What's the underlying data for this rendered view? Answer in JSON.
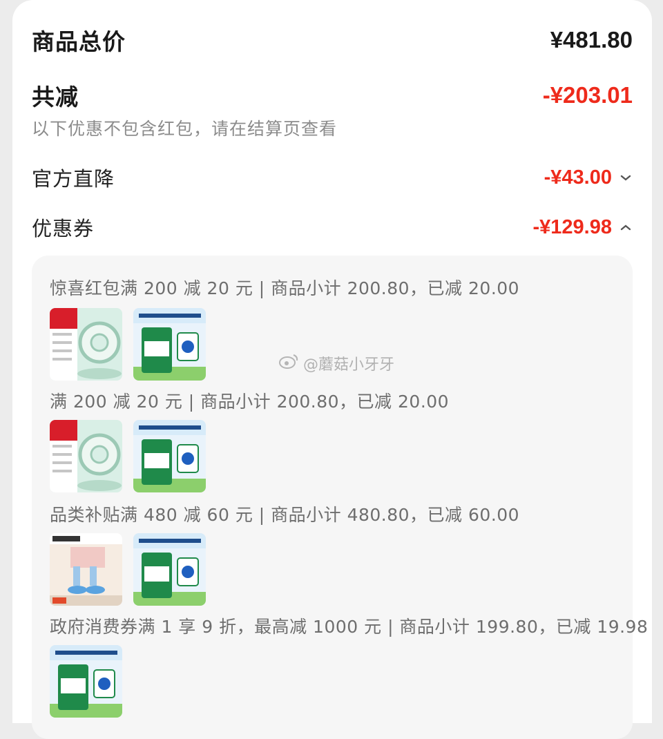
{
  "summary": {
    "total_label": "商品总价",
    "total_value": "¥481.80",
    "reduce_label": "共减",
    "reduce_value": "-¥203.01",
    "note": "以下优惠不包含红包，请在结算页查看"
  },
  "discounts": {
    "official": {
      "label": "官方直降",
      "value": "-¥43.00"
    },
    "coupon": {
      "label": "优惠券",
      "value": "-¥129.98"
    }
  },
  "coupons": [
    {
      "text": "惊喜红包满 200 减 20 元 | 商品小计 200.80，已减 20.00"
    },
    {
      "text": "满 200 减 20 元 | 商品小计 200.80，已减 20.00"
    },
    {
      "text": "品类补贴满 480 减 60 元 | 商品小计 480.80，已减 60.00"
    },
    {
      "text": "政府消费券满 1 享 9 折，最高减 1000 元 | 商品小计 199.80，已减 19.98"
    }
  ],
  "watermark": "@蘑菇小牙牙",
  "colors": {
    "accent_red": "#ee2a1b",
    "muted": "#8c8c8c",
    "panel": "#f6f6f6"
  }
}
